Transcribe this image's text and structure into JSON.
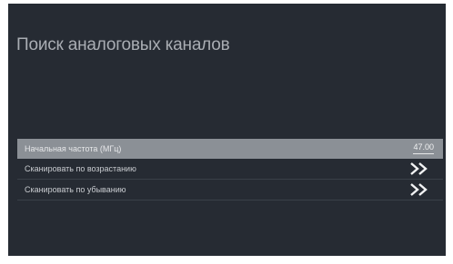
{
  "screen": {
    "title": "Поиск аналоговых каналов"
  },
  "menu": {
    "items": [
      {
        "label": "Начальная частота (МГц)",
        "value": "47.00",
        "selected": true
      },
      {
        "label": "Сканировать по возрастанию",
        "icon": "double-chevron-right-icon"
      },
      {
        "label": "Сканировать по убыванию",
        "icon": "double-chevron-right-icon"
      }
    ]
  },
  "colors": {
    "background": "#262b33",
    "selected_row": "#8b9096",
    "text": "#c9ccd0",
    "title": "#a9adb3"
  }
}
